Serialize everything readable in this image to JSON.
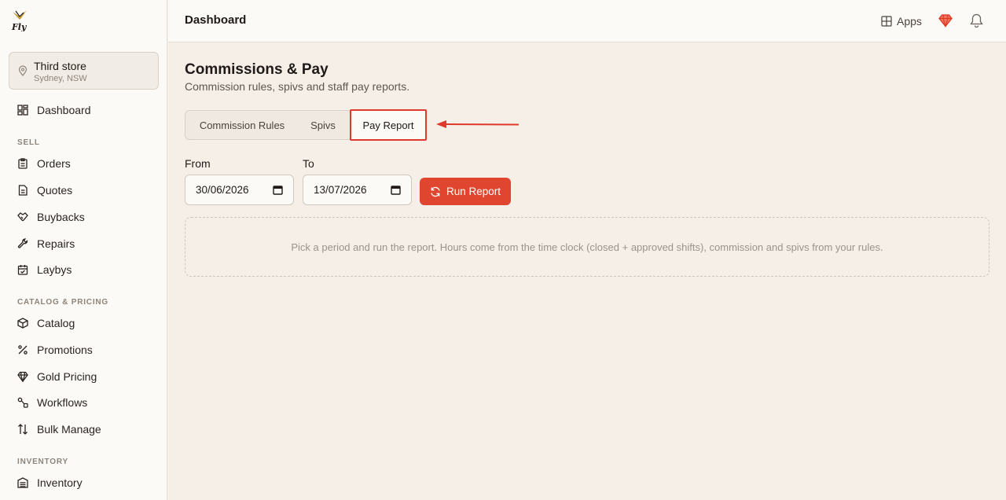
{
  "brand": {
    "logo_text": "Fly"
  },
  "store": {
    "name": "Third store",
    "location": "Sydney, NSW"
  },
  "sidebar": {
    "top_items": [
      {
        "label": "Dashboard",
        "icon": "dashboard-icon"
      }
    ],
    "sections": [
      {
        "label": "SELL",
        "items": [
          {
            "label": "Orders",
            "icon": "clipboard-icon"
          },
          {
            "label": "Quotes",
            "icon": "document-icon"
          },
          {
            "label": "Buybacks",
            "icon": "handshake-icon"
          },
          {
            "label": "Repairs",
            "icon": "wrench-icon"
          },
          {
            "label": "Laybys",
            "icon": "calendar-check-icon"
          }
        ]
      },
      {
        "label": "CATALOG & PRICING",
        "items": [
          {
            "label": "Catalog",
            "icon": "box-icon"
          },
          {
            "label": "Promotions",
            "icon": "percent-icon"
          },
          {
            "label": "Gold Pricing",
            "icon": "gem-icon"
          },
          {
            "label": "Workflows",
            "icon": "workflow-icon"
          },
          {
            "label": "Bulk Manage",
            "icon": "sort-arrows-icon"
          }
        ]
      },
      {
        "label": "INVENTORY",
        "items": [
          {
            "label": "Inventory",
            "icon": "warehouse-icon"
          }
        ]
      }
    ]
  },
  "topbar": {
    "title": "Dashboard",
    "apps_label": "Apps"
  },
  "page": {
    "title": "Commissions & Pay",
    "subtitle": "Commission rules, spivs and staff pay reports.",
    "tabs": [
      {
        "label": "Commission Rules",
        "active": false
      },
      {
        "label": "Spivs",
        "active": false
      },
      {
        "label": "Pay Report",
        "active": true
      }
    ],
    "from": {
      "label": "From",
      "value": "30/06/2026"
    },
    "to": {
      "label": "To",
      "value": "13/07/2026"
    },
    "run_label": "Run Report",
    "empty_message": "Pick a period and run the report. Hours come from the time clock (closed + approved shifts), commission and spivs from your rules."
  },
  "colors": {
    "accent": "#e0452f",
    "highlight": "#e0392b",
    "background": "#f5efe8",
    "surface": "#fcfaf7"
  }
}
